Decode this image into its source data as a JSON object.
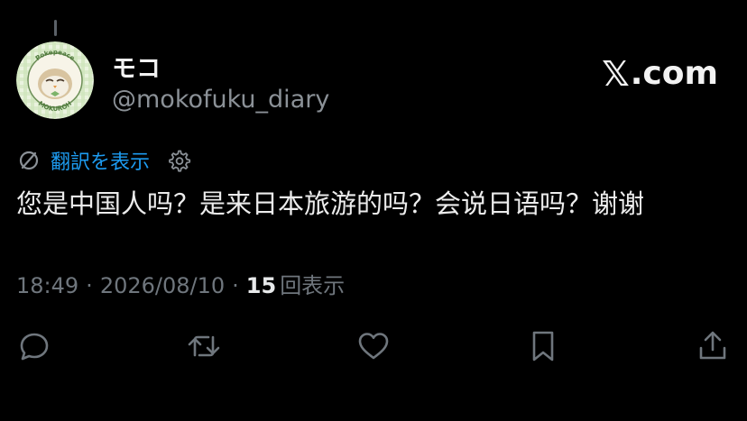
{
  "post": {
    "author": {
      "display_name": "モコ",
      "handle": "@mokofuku_diary",
      "avatar_badge_top": "Pokepeace",
      "avatar_badge_bottom": "MOKUROH"
    },
    "brand": {
      "text": ".com",
      "icon": "x-logo-icon"
    },
    "translate": {
      "label": "翻訳を表示",
      "icon": "translate-icon",
      "settings_icon": "gear-icon"
    },
    "text": "您是中国人吗？是来日本旅游的吗？会说日语吗？谢谢",
    "meta": {
      "time": "18:49",
      "separator": "·",
      "date": "2026/08/10",
      "views_count": "15",
      "views_label": "回表示"
    },
    "actions": [
      {
        "name": "reply",
        "icon": "reply-icon"
      },
      {
        "name": "repost",
        "icon": "repost-icon"
      },
      {
        "name": "like",
        "icon": "heart-icon"
      },
      {
        "name": "bookmark",
        "icon": "bookmark-icon"
      },
      {
        "name": "share",
        "icon": "share-icon"
      }
    ]
  },
  "colors": {
    "background": "#000000",
    "text_primary": "#e7e9ea",
    "text_secondary": "#8b9197",
    "accent": "#1d9bf0",
    "icon": "#6f767d"
  }
}
